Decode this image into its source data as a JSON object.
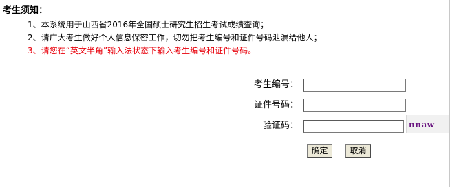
{
  "notice": {
    "title": "考生须知：",
    "items": [
      "1、本系统用于山西省2016年全国硕士研究生招生考试成绩查询；",
      "2、请广大考生做好个人信息保密工作，切勿把考生编号和证件号码泄漏给他人；",
      "3、请您在“英文半角”输入法状态下输入考生编号和证件号码。"
    ]
  },
  "form": {
    "exam_id_label": "考生编号：",
    "exam_id_value": "",
    "id_number_label": "证件号码：",
    "id_number_value": "",
    "captcha_label": "验证码：",
    "captcha_value": "",
    "captcha_text": "nnaw"
  },
  "buttons": {
    "confirm_label": "确定",
    "cancel_label": "取消"
  },
  "colors": {
    "warning_text": "#e8000b",
    "captcha_text": "#6a1580",
    "captcha_background": "#f1f1f1",
    "button_background": "#ece9d8"
  }
}
